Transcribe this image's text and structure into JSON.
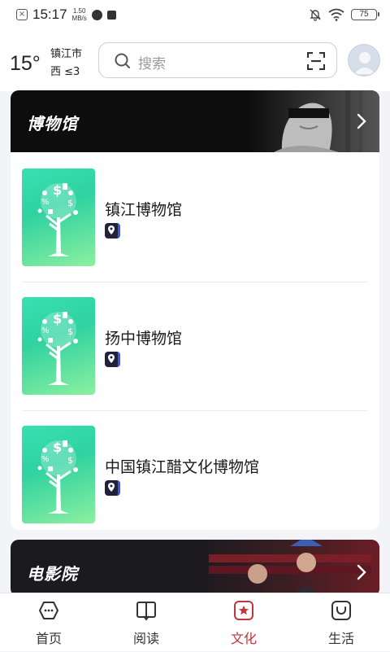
{
  "status_bar": {
    "time": "15:17",
    "speed_value": "1.50",
    "speed_unit": "MB/s",
    "battery": "75"
  },
  "header": {
    "temperature": "15°",
    "city": "镇江市",
    "wind": "西  ≤3",
    "search_placeholder": "搜索"
  },
  "museum_section": {
    "title": "博物馆",
    "items": [
      {
        "name": "镇江博物馆"
      },
      {
        "name": "扬中博物馆"
      },
      {
        "name": "中国镇江醋文化博物馆"
      }
    ]
  },
  "cinema_section": {
    "title": "电影院"
  },
  "tabbar": {
    "tabs": [
      {
        "label": "首页",
        "icon": "home-icon"
      },
      {
        "label": "阅读",
        "icon": "book-icon"
      },
      {
        "label": "文化",
        "icon": "culture-star-icon"
      },
      {
        "label": "生活",
        "icon": "life-bag-icon"
      }
    ],
    "active": "文化"
  },
  "colors": {
    "accent_red": "#c4343b",
    "thumb_green": "#39e0b2",
    "banner_black": "#0d0d0d"
  }
}
